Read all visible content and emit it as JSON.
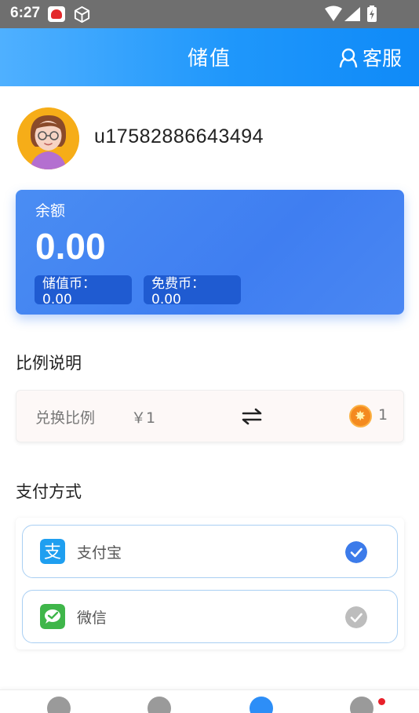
{
  "status_bar": {
    "time": "6:27",
    "icons": [
      "app-badge-icon",
      "package-icon",
      "wifi-icon",
      "signal-icon",
      "battery-charging-icon"
    ]
  },
  "header": {
    "title": "储值",
    "service_label": "客服"
  },
  "user": {
    "username": "u17582886643494"
  },
  "balance": {
    "label": "余额",
    "amount": "0.00",
    "stored_coin": "储值币：0.00",
    "free_coin": "免费币：0.00"
  },
  "ratio": {
    "title": "比例说明",
    "label": "兑换比例",
    "yuan": "￥1",
    "coin_value": "1"
  },
  "payment": {
    "title": "支付方式",
    "options": [
      {
        "label": "支付宝",
        "selected": true,
        "icon": "alipay-icon"
      },
      {
        "label": "微信",
        "selected": false,
        "icon": "wechat-icon"
      }
    ]
  },
  "colors": {
    "header": "#1f97fb",
    "card": "#3f7ef1",
    "chip": "#1f5bd1",
    "check_active": "#3c7bea",
    "check_inactive": "#bdbdbd",
    "alipay": "#1f9ff0",
    "wechat": "#3fb64a"
  }
}
